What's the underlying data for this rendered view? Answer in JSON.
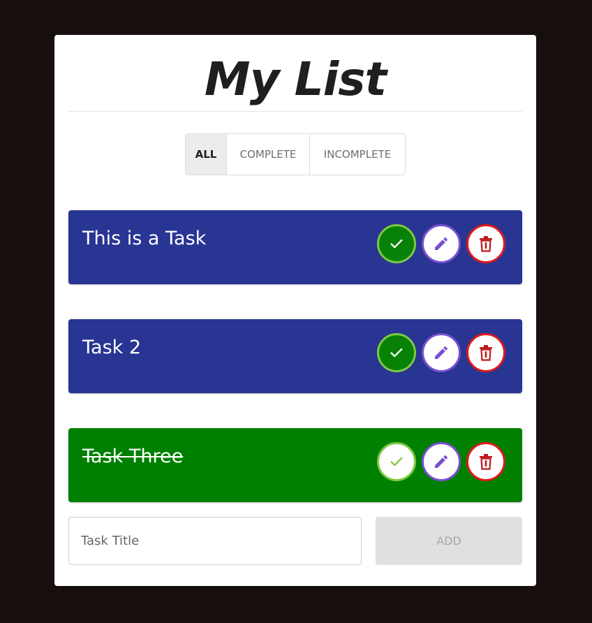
{
  "header": {
    "title": "My List"
  },
  "filters": [
    {
      "label": "ALL",
      "active": true
    },
    {
      "label": "COMPLETE",
      "active": false
    },
    {
      "label": "INCOMPLETE",
      "active": false
    }
  ],
  "tasks": [
    {
      "title": "This is a Task",
      "completed": false,
      "color": "#283593"
    },
    {
      "title": "Task 2",
      "completed": false,
      "color": "#283593"
    },
    {
      "title": "Task Three",
      "completed": true,
      "color": "#008000"
    }
  ],
  "task_actions": {
    "complete_icon": "check-icon",
    "edit_icon": "pencil-icon",
    "delete_icon": "trash-icon"
  },
  "new_task": {
    "placeholder": "Task Title",
    "value": ""
  },
  "add_button": {
    "label": "ADD"
  },
  "colors": {
    "background": "#170f0e",
    "card": "#ffffff",
    "incomplete_task": "#283593",
    "complete_task": "#008000",
    "check_border": "#7fc840",
    "edit_border": "#7a4fd0",
    "delete_border": "#e0191d"
  }
}
